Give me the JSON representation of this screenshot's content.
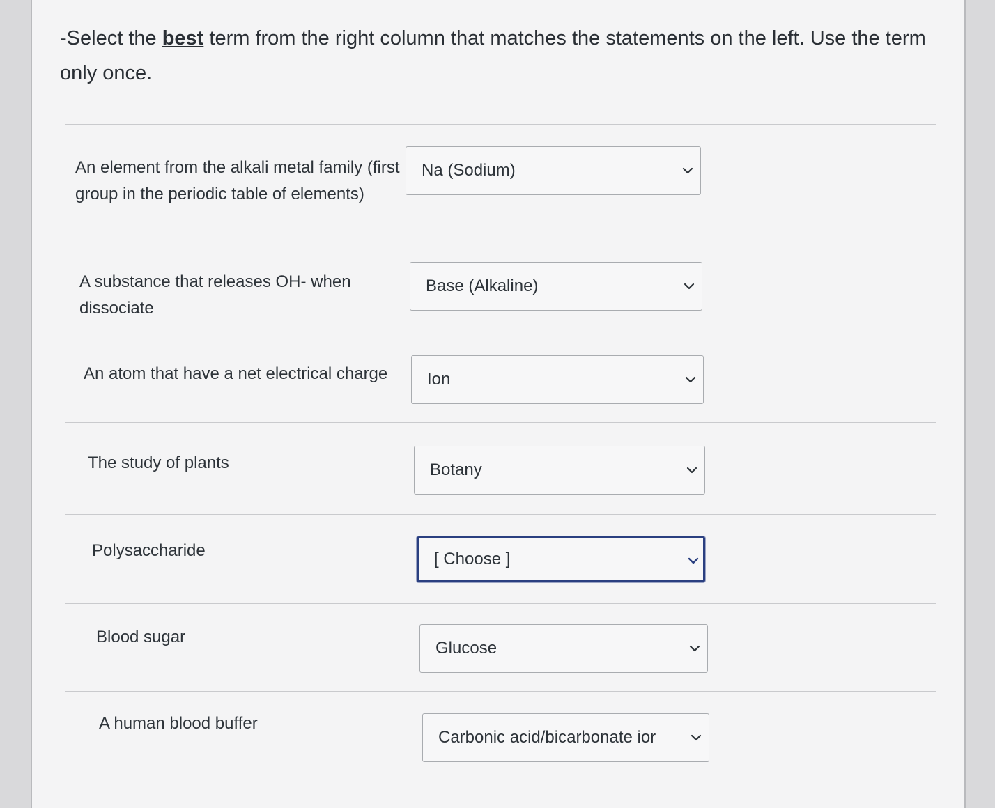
{
  "question": {
    "prompt_prefix": "-Select the ",
    "prompt_bold": "best",
    "prompt_suffix": " term from the right column that matches the statements on the left. Use the term only once."
  },
  "rows": [
    {
      "statement": "An element from the alkali metal family (first group in the periodic table of elements)",
      "selected": "Na (Sodium)"
    },
    {
      "statement": "A substance that releases OH- when dissociate",
      "selected": "Base (Alkaline)"
    },
    {
      "statement": "An atom that have a net electrical charge",
      "selected": "Ion"
    },
    {
      "statement": "The study of plants",
      "selected": "Botany"
    },
    {
      "statement": "Polysaccharide",
      "selected": "[ Choose ]"
    },
    {
      "statement": "Blood sugar",
      "selected": "Glucose"
    },
    {
      "statement": "A human blood buffer",
      "selected": "Carbonic acid/bicarbonate ior"
    }
  ],
  "icons": {
    "dropdown": "chevron-down-icon"
  },
  "colors": {
    "focus_border": "#2a3f80",
    "background": "#f4f4f5"
  }
}
